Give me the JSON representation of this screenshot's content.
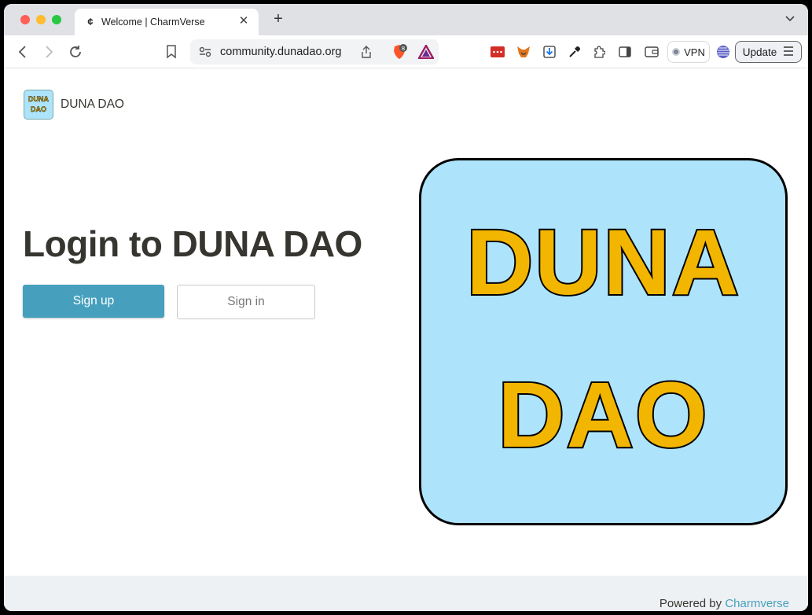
{
  "browser": {
    "tab_title": "Welcome | CharmVerse",
    "tab_favicon": "¢",
    "address": "community.dunadao.org",
    "brave_badge": "8",
    "vpn_label": "VPN",
    "update_label": "Update"
  },
  "page": {
    "brand_logo_line1": "DUNA",
    "brand_logo_line2": "DAO",
    "brand_name": "DUNA DAO",
    "heading": "Login to DUNA DAO",
    "signup_label": "Sign up",
    "signin_label": "Sign in",
    "hero_line1": "DUNA",
    "hero_line2": "DAO",
    "footer_prefix": "Powered by",
    "footer_link": "Charmverse"
  },
  "colors": {
    "accent": "#46a0bd",
    "hero_bg": "#aee4fb",
    "hero_text": "#f3b600",
    "text": "#37352f"
  }
}
